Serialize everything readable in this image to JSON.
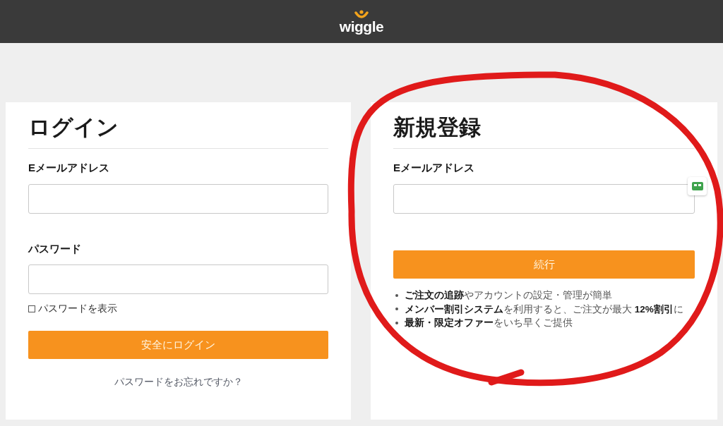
{
  "header": {
    "logo": "wiggle"
  },
  "login": {
    "title": "ログイン",
    "email_label": "Eメールアドレス",
    "password_label": "パスワード",
    "show_password": {
      "label": "パスワードを表示",
      "checked": false
    },
    "submit": "安全にログイン",
    "forgot_link": "パスワードをお忘れですか？"
  },
  "register": {
    "title": "新規登録",
    "email_label": "Eメールアドレス",
    "submit": "続行",
    "benefits": [
      "**ご注文の追跡**やアカウントの設定・管理が簡単",
      "**メンバー割引システム**を利用すると、ご注文が最大 **12%割引**に",
      "**最新・限定オファー**をいち早くご提供"
    ]
  }
}
